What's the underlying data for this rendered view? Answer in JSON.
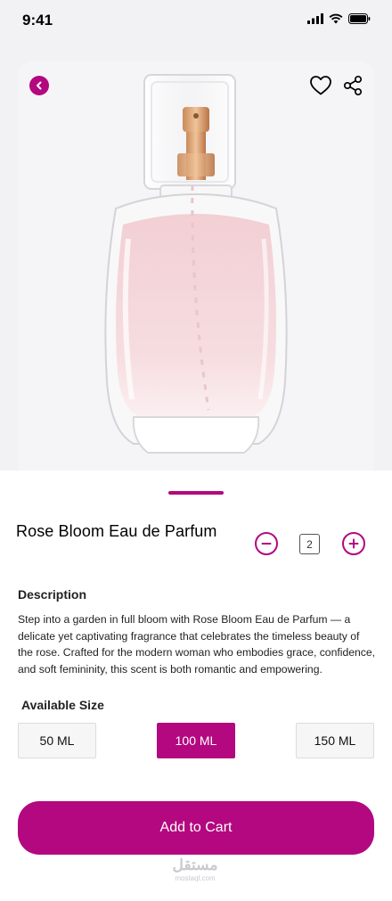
{
  "status_bar": {
    "time": "9:41"
  },
  "product": {
    "title": "Rose Bloom Eau de Parfum",
    "quantity": "2"
  },
  "description": {
    "heading": "Description",
    "text": "Step into a garden in full bloom with Rose Bloom Eau de Parfum — a delicate yet captivating fragrance that celebrates the timeless beauty of the rose. Crafted for the modern woman who embodies grace, confidence, and soft femininity, this scent is both romantic and empowering."
  },
  "sizes": {
    "heading": "Available Size",
    "options": [
      "50 ML",
      "100 ML",
      "150 ML"
    ],
    "selected": "100 ML"
  },
  "actions": {
    "add_to_cart": "Add to Cart"
  },
  "watermark": {
    "arabic": "مستقل",
    "latin": "mostaql.com"
  },
  "icons": {
    "back": "chevron-left-icon",
    "favorite": "heart-icon",
    "share": "share-icon",
    "minus": "minus-circle-icon",
    "plus": "plus-circle-icon"
  },
  "colors": {
    "accent": "#b3087f",
    "background_top": "#f2f2f4"
  }
}
